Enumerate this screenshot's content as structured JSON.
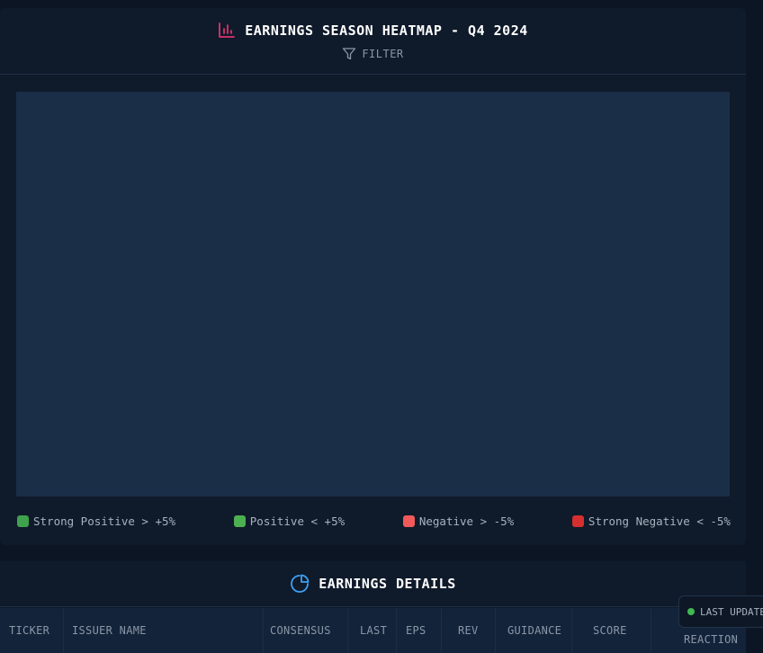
{
  "heatmap": {
    "title": "EARNINGS SEASON HEATMAP - Q4 2024",
    "title_icon": "bar-chart-icon",
    "title_icon_color": "#e0316e",
    "filter_label": "FILTER",
    "filter_icon": "filter-icon",
    "legend": [
      {
        "label": "Strong Positive > +5%",
        "color": "#3fa34d"
      },
      {
        "label": "Positive < +5%",
        "color": "#4caf50"
      },
      {
        "label": "Negative > -5%",
        "color": "#f05a5a"
      },
      {
        "label": "Strong Negative < -5%",
        "color": "#d62f2f"
      }
    ]
  },
  "details": {
    "title": "EARNINGS DETAILS",
    "title_icon": "pie-chart-icon",
    "title_icon_color": "#3da2f5",
    "columns": {
      "ticker": "TICKER",
      "issuer": "ISSUER NAME",
      "consensus": "CONSENSUS",
      "last": "LAST",
      "eps": "EPS",
      "rev": "REV",
      "guidance": "GUIDANCE",
      "score": "SCORE",
      "reaction": "REACTION"
    }
  },
  "status": {
    "last_update_label": "LAST UPDATE",
    "live_color": "#3fb950"
  }
}
